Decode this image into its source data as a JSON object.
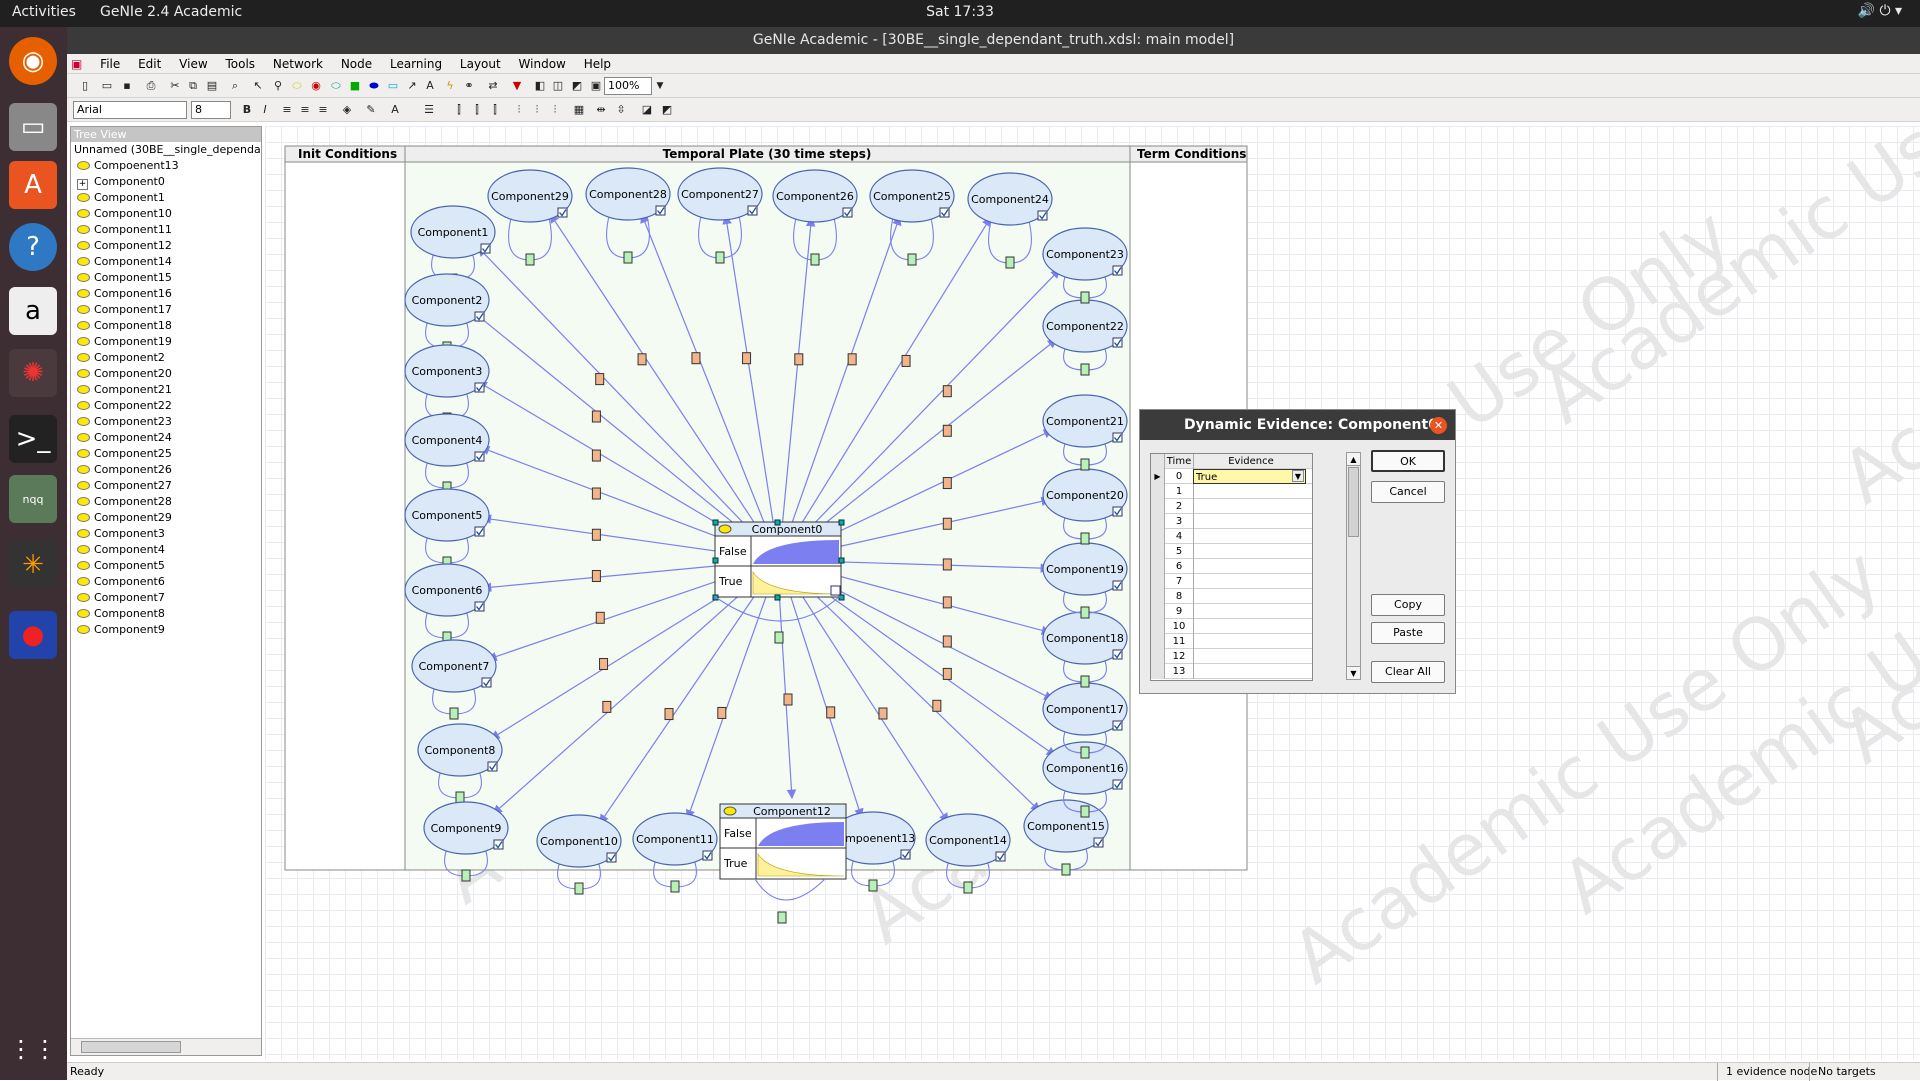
{
  "topbar": {
    "activities": "Activities",
    "app_menu": "GeNIe 2.4 Academic",
    "clock": "Sat 17:33",
    "tray": "🔊  ⏻  ▾"
  },
  "window": {
    "title": "GeNIe Academic - [30BE__single_dependant_truth.xdsl: main model]"
  },
  "menu": [
    "File",
    "Edit",
    "View",
    "Tools",
    "Network",
    "Node",
    "Learning",
    "Layout",
    "Window",
    "Help"
  ],
  "toolbar": {
    "zoom": "100%",
    "font": "Arial",
    "font_size": "8"
  },
  "tree": {
    "title": "Tree View",
    "root": "Unnamed (30BE__single_dependa",
    "items": [
      "Compoenent13",
      "Component0",
      "Component1",
      "Component10",
      "Component11",
      "Component12",
      "Component14",
      "Component15",
      "Component16",
      "Component17",
      "Component18",
      "Component19",
      "Component2",
      "Component20",
      "Component21",
      "Component22",
      "Component23",
      "Component24",
      "Component25",
      "Component26",
      "Component27",
      "Component28",
      "Component29",
      "Component3",
      "Component4",
      "Component5",
      "Component6",
      "Component7",
      "Component8",
      "Component9"
    ]
  },
  "plate": {
    "init": "Init Conditions",
    "temporal": "Temporal Plate (30 time steps)",
    "term": "Term Conditions"
  },
  "bubble_nodes": [
    "Component1",
    "Component2",
    "Component3",
    "Component4",
    "Component5",
    "Component6",
    "Component7",
    "Component8",
    "Component9",
    "Component10",
    "Component11",
    "Compoenent13",
    "Component14",
    "Component15",
    "Component16",
    "Component17",
    "Component18",
    "Component19",
    "Component20",
    "Component21",
    "Component22",
    "Component23",
    "Component24",
    "Component25",
    "Component26",
    "Component27",
    "Component28",
    "Component29"
  ],
  "bar_nodes": {
    "main": {
      "title": "Component0",
      "s1": "False",
      "s2": "True"
    },
    "child": {
      "title": "Component12",
      "s1": "False",
      "s2": "True"
    }
  },
  "watermark": "Academic Use Only",
  "dialog": {
    "title": "Dynamic Evidence: Component0",
    "col_time": "Time",
    "col_evidence": "Evidence",
    "rows": [
      {
        "t": "0",
        "v": "True"
      },
      {
        "t": "1",
        "v": ""
      },
      {
        "t": "2",
        "v": ""
      },
      {
        "t": "3",
        "v": ""
      },
      {
        "t": "4",
        "v": ""
      },
      {
        "t": "5",
        "v": ""
      },
      {
        "t": "6",
        "v": ""
      },
      {
        "t": "7",
        "v": ""
      },
      {
        "t": "8",
        "v": ""
      },
      {
        "t": "9",
        "v": ""
      },
      {
        "t": "10",
        "v": ""
      },
      {
        "t": "11",
        "v": ""
      },
      {
        "t": "12",
        "v": ""
      },
      {
        "t": "13",
        "v": ""
      }
    ],
    "ok": "OK",
    "cancel": "Cancel",
    "copy": "Copy",
    "paste": "Paste",
    "clear": "Clear All"
  },
  "status": {
    "left": "Ready",
    "evidence": "1 evidence node",
    "targets": "No targets"
  },
  "colors": {
    "node_fill": "#dbe8f7",
    "node_border": "#4a64b0",
    "arc": "#7b7ff0",
    "plate_bg": "#f3fbf3",
    "bar": "#7b7ff0"
  }
}
